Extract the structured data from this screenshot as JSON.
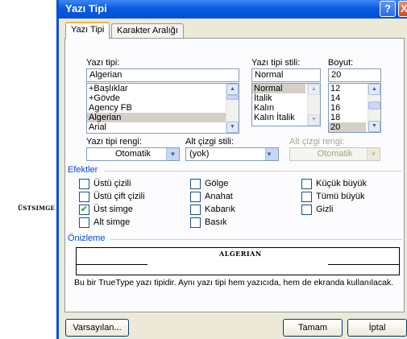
{
  "outside_label": "ÜSTSIMGE",
  "dialog": {
    "title": "Yazı Tipi",
    "help_btn": "?",
    "close_btn": "X",
    "tabs": [
      {
        "label": "Yazı Tipi",
        "active": true
      },
      {
        "label": "Karakter Aralığı",
        "active": false
      }
    ]
  },
  "font": {
    "label": "Yazı tipi:",
    "value": "Algerian",
    "items": [
      "+Başlıklar",
      "+Gövde",
      "Agency FB",
      "Algerian",
      "Arial"
    ],
    "selected": "Algerian"
  },
  "style": {
    "label": "Yazı tipi stili:",
    "value": "Normal",
    "items": [
      "Normal",
      "İtalik",
      "Kalın",
      "Kalın İtalik"
    ],
    "selected": "Normal"
  },
  "size": {
    "label": "Boyut:",
    "value": "20",
    "items": [
      "12",
      "14",
      "16",
      "18",
      "20"
    ],
    "selected": "20"
  },
  "font_color": {
    "label": "Yazı tipi rengi:",
    "value": "Otomatik"
  },
  "underline_style": {
    "label": "Alt çizgi stili:",
    "value": "(yok)"
  },
  "underline_color": {
    "label": "Alt çizgi rengi:",
    "value": "Otomatik"
  },
  "effects": {
    "title": "Efektler",
    "items": [
      {
        "label": "Üstü çizili",
        "checked": false
      },
      {
        "label": "Üstü çift çizili",
        "checked": false
      },
      {
        "label": "Üst simge",
        "checked": true
      },
      {
        "label": "Alt simge",
        "checked": false
      },
      {
        "label": "Gölge",
        "checked": false
      },
      {
        "label": "Anahat",
        "checked": false
      },
      {
        "label": "Kabarık",
        "checked": false
      },
      {
        "label": "Basık",
        "checked": false
      },
      {
        "label": "Küçük büyük",
        "checked": false
      },
      {
        "label": "Tümü büyük",
        "checked": false
      },
      {
        "label": "Gizli",
        "checked": false
      }
    ]
  },
  "preview": {
    "title": "Önizleme",
    "sample": "ALGERIAN",
    "description": "Bu bir TrueType yazı tipidir. Aynı yazı tipi hem yazıcıda, hem de ekranda kullanılacak."
  },
  "buttons": {
    "default": "Varsayılan...",
    "ok": "Tamam",
    "cancel": "İptal"
  },
  "colors": {
    "title_bar": "#0a5be0",
    "dialog_bg": "#ece9d8",
    "selection": "#316ac5"
  }
}
